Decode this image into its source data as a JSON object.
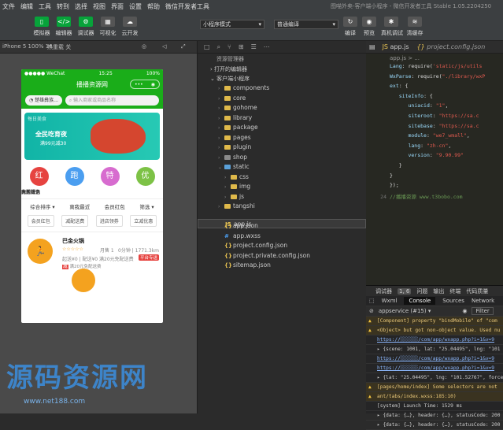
{
  "menubar": {
    "items": [
      "文件",
      "编辑",
      "工具",
      "转到",
      "选择",
      "视图",
      "界面",
      "设置",
      "帮助",
      "微信开发者工具"
    ],
    "title": "图喵外卖-客户端小程序 - 微信开发者工具 Stable 1.05.2204250"
  },
  "toolbar": {
    "buttons": [
      "模拟器",
      "编辑器",
      "调试器",
      "可视化",
      "云开发"
    ],
    "mode_select": "小程序模式",
    "compile_select": "普通编译",
    "right_buttons": [
      "编译",
      "预览",
      "真机调试",
      "清缓存"
    ]
  },
  "simulator": {
    "device": "iPhone 5 100% 16",
    "network": "热重载 关",
    "status_carrier": "●●●●● WeChat",
    "status_time": "15:25",
    "status_battery": "100%",
    "nav_title": "播播资源网",
    "city": "楚雄彝族...",
    "search_placeholder": "输入商家或商品名称",
    "banner_small": "每日美食",
    "banner_title": "全民吃育夜",
    "banner_sub": "满99元减30",
    "categories": [
      {
        "label": "我的红包",
        "color": "#e64340",
        "icon": "红"
      },
      {
        "label": "跑腿服务",
        "color": "#4b9ef0",
        "icon": "跑"
      },
      {
        "label": "天天特价",
        "color": "#d76ccf",
        "icon": "特"
      },
      {
        "label": "为您优选",
        "color": "#7dc246",
        "icon": "优"
      }
    ],
    "sorts": [
      "综合排序 ▾",
      "离我最近",
      "会员红包",
      "筛选 ▾"
    ],
    "filters": [
      "会员红包",
      "减配送费",
      "进店领券",
      "立减优惠"
    ],
    "shop_name": "巴金火锅",
    "shop_stars": "☆☆☆☆☆",
    "shop_month": "月售 1",
    "shop_dist": "0分钟 | 1771.3km",
    "shop_line3": "起送¥0 | 配送¥0   满20元免配送费",
    "shop_tag": "平台专送",
    "shop_act": "满20元免配送费",
    "shop_act_tag": "减"
  },
  "explorer": {
    "tabs": [
      "□",
      "⌕",
      "⑂",
      "⊞",
      "☰",
      "⋯"
    ],
    "title": "资源管理器",
    "open_editors": "打开的编辑器",
    "project": "客户端小程序",
    "tree": [
      {
        "name": "components",
        "type": "folder",
        "depth": 1
      },
      {
        "name": "core",
        "type": "folder",
        "depth": 1
      },
      {
        "name": "gohome",
        "type": "folder",
        "depth": 1
      },
      {
        "name": "library",
        "type": "folder",
        "depth": 1
      },
      {
        "name": "package",
        "type": "folder",
        "depth": 1
      },
      {
        "name": "pages",
        "type": "folder",
        "depth": 1
      },
      {
        "name": "plugin",
        "type": "folder",
        "depth": 1
      },
      {
        "name": "shop",
        "type": "folder",
        "depth": 1
      },
      {
        "name": "static",
        "type": "folder-open",
        "depth": 1
      },
      {
        "name": "css",
        "type": "folder",
        "depth": 2
      },
      {
        "name": "img",
        "type": "folder",
        "depth": 2
      },
      {
        "name": "js",
        "type": "folder",
        "depth": 2
      },
      {
        "name": "tangshi",
        "type": "folder",
        "depth": 1
      },
      {
        "name": "app.js",
        "type": "js",
        "depth": 1
      },
      {
        "name": "app.json",
        "type": "json",
        "depth": 1
      },
      {
        "name": "app.wxss",
        "type": "wxss",
        "depth": 1
      },
      {
        "name": "project.config.json",
        "type": "json",
        "depth": 1
      },
      {
        "name": "project.private.config.json",
        "type": "json",
        "depth": 1
      },
      {
        "name": "sitemap.json",
        "type": "json",
        "depth": 1
      }
    ]
  },
  "editor": {
    "tabs": [
      "app.js",
      "project.config.json"
    ],
    "breadcrumb": "app.js > ...",
    "lines": [
      {
        "n": "",
        "html": "<span class='k'>Lang</span><span class='p'>: require(</span><span class='s'>'static/js/utils</span>"
      },
      {
        "n": "",
        "html": "<span class='k'>WxParse</span><span class='p'>: require(</span><span class='s'>\"./library/wxP</span>"
      },
      {
        "n": "",
        "html": "<span class='k'>ext</span><span class='p'>: {</span>"
      },
      {
        "n": "",
        "html": "&nbsp;&nbsp;&nbsp;<span class='k'>siteInfo</span><span class='p'>: {</span>"
      },
      {
        "n": "",
        "html": "&nbsp;&nbsp;&nbsp;&nbsp;&nbsp;&nbsp;<span class='k'>uniacid</span><span class='p'>: </span><span class='s'>\"1\"</span><span class='p'>,</span>"
      },
      {
        "n": "",
        "html": "&nbsp;&nbsp;&nbsp;&nbsp;&nbsp;&nbsp;<span class='k'>siteroot</span><span class='p'>: </span><span class='s'>\"https://sa.c</span>"
      },
      {
        "n": "",
        "html": "&nbsp;&nbsp;&nbsp;&nbsp;&nbsp;&nbsp;<span class='k'>sitebase</span><span class='p'>: </span><span class='s'>\"https://sa.c</span>"
      },
      {
        "n": "",
        "html": "&nbsp;&nbsp;&nbsp;&nbsp;&nbsp;&nbsp;<span class='k'>module</span><span class='p'>: </span><span class='s'>\"we7_wmall\"</span><span class='p'>,</span>"
      },
      {
        "n": "",
        "html": "&nbsp;&nbsp;&nbsp;&nbsp;&nbsp;&nbsp;<span class='k'>lang</span><span class='p'>: </span><span class='s'>\"zh-cn\"</span><span class='p'>,</span>"
      },
      {
        "n": "",
        "html": "&nbsp;&nbsp;&nbsp;&nbsp;&nbsp;&nbsp;<span class='k'>version</span><span class='p'>: </span><span class='s'>\"9.90.99\"</span>"
      },
      {
        "n": "",
        "html": "&nbsp;&nbsp;&nbsp;<span class='p'>}</span>"
      },
      {
        "n": "",
        "html": "<span class='p'>}</span>"
      },
      {
        "n": "",
        "html": "<span class='p'>});</span>"
      },
      {
        "n": "24",
        "html": "<span class='cm'>//播播资源 www.t3bobo.com</span>"
      }
    ]
  },
  "debug": {
    "tabs": [
      "调试器",
      "1, 6",
      "问题",
      "输出",
      "终端",
      "代码质量"
    ],
    "devtools_tabs": [
      "Wxml",
      "Console",
      "Sources",
      "Network"
    ],
    "context": "appservice (#15)",
    "filter_label": "Filter",
    "logs": [
      {
        "type": "warn",
        "text": "[Component] property \"bindMobile\" of \"com"
      },
      {
        "type": "warn",
        "text": "<Object> but got non-object value. Used nu"
      },
      {
        "type": "link",
        "text": "https://░░░░░░/com/app/wxapp.php?i=1&v=9"
      },
      {
        "type": "info",
        "text": "▸ {scene: 1001, lat: \"25.04495\", lng: \"101"
      },
      {
        "type": "link",
        "text": "https://░░░░░░/com/app/wxapp.php?i=1&v=9"
      },
      {
        "type": "link",
        "text": "https://░░░░░░/com/app/wxapp.php?i=1&v=9"
      },
      {
        "type": "info",
        "text": "▸ {lat: \"25.04495\", lng: \"101.52767\", force"
      },
      {
        "type": "warn",
        "text": "[pages/home/index] Some selectors are not"
      },
      {
        "type": "warn",
        "text": "ant/tabs/index.wxss:185:10)"
      },
      {
        "type": "info",
        "text": "[system] Launch Time: 1529 ms"
      },
      {
        "type": "info",
        "text": "▸ {data: {…}, header: {…}, statusCode: 200"
      },
      {
        "type": "info",
        "text": "▸ {data: {…}, header: {…}, statusCode: 200"
      }
    ]
  },
  "watermark": {
    "big": "源码资源网",
    "url": "www.net188.com"
  }
}
